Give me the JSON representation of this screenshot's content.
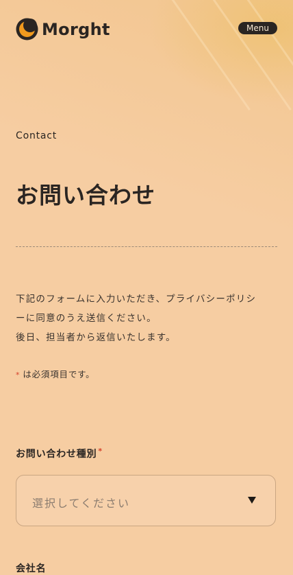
{
  "brand": {
    "name": "Morght",
    "logo_icon": "moon-logo-icon",
    "colors": {
      "background": "#f6cda2",
      "logo_orange": "#f09a1e",
      "text": "#2a2522",
      "required": "#d6402a"
    }
  },
  "header": {
    "menu_label": "Menu"
  },
  "page": {
    "eyebrow": "Contact",
    "title": "お問い合わせ"
  },
  "intro": {
    "line1": "下記のフォームに入力いただき、プライバシーポリシ",
    "line2": "ーに同意のうえ送信ください。",
    "line3": "後日、担当者から返信いたします。"
  },
  "required_note": {
    "star": "*",
    "text": "は必須項目です。"
  },
  "form": {
    "inquiry_type": {
      "label": "お問い合わせ種別",
      "required_mark": "*",
      "placeholder": "選択してください"
    },
    "company": {
      "label": "会社名"
    }
  }
}
